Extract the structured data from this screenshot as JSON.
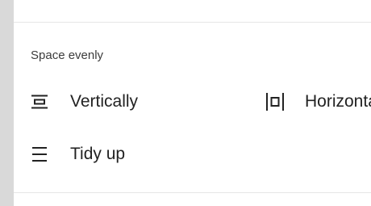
{
  "panel": {
    "section_heading": "Space evenly",
    "actions": [
      {
        "id": "vertical",
        "label": "Vertically",
        "icon": "distribute-vertical-icon"
      },
      {
        "id": "horizontal",
        "label": "Horizontally",
        "icon": "distribute-horizontal-icon"
      },
      {
        "id": "tidy",
        "label": "Tidy up",
        "icon": "tidy-up-icon"
      }
    ]
  },
  "colors": {
    "background": "#d9d9d9",
    "panel": "#ffffff",
    "text": "#222222",
    "heading": "#3c3c3c"
  }
}
